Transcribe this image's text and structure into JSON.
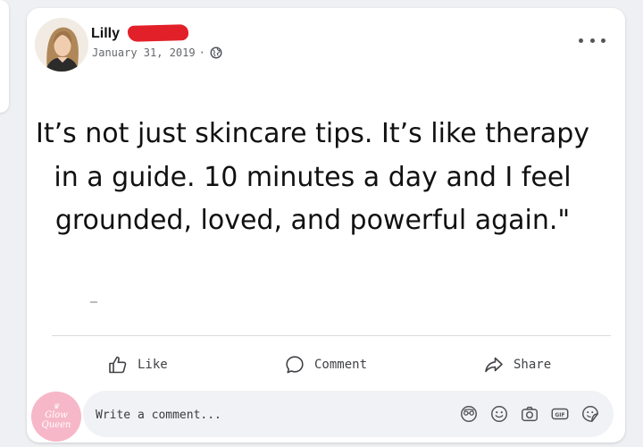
{
  "post": {
    "author": "Lilly",
    "date": "January 31, 2019",
    "separator": "·",
    "text": "It’s not just skincare tips. It’s like therapy in a guide. 10 minutes a day and I feel grounded, loved, and powerful again.\""
  },
  "actions": {
    "like": "Like",
    "comment": "Comment",
    "share": "Share"
  },
  "comment_box": {
    "placeholder": "Write a comment...",
    "commenter_logo_line1": "Glow",
    "commenter_logo_line2": "Queen",
    "icons": [
      "avatar-sticker-icon",
      "emoji-icon",
      "camera-icon",
      "gif-icon",
      "sticker-icon"
    ]
  },
  "colors": {
    "redaction": "#e2202a",
    "commenter_avatar": "#f6b8c8",
    "background": "#eef0f3"
  }
}
